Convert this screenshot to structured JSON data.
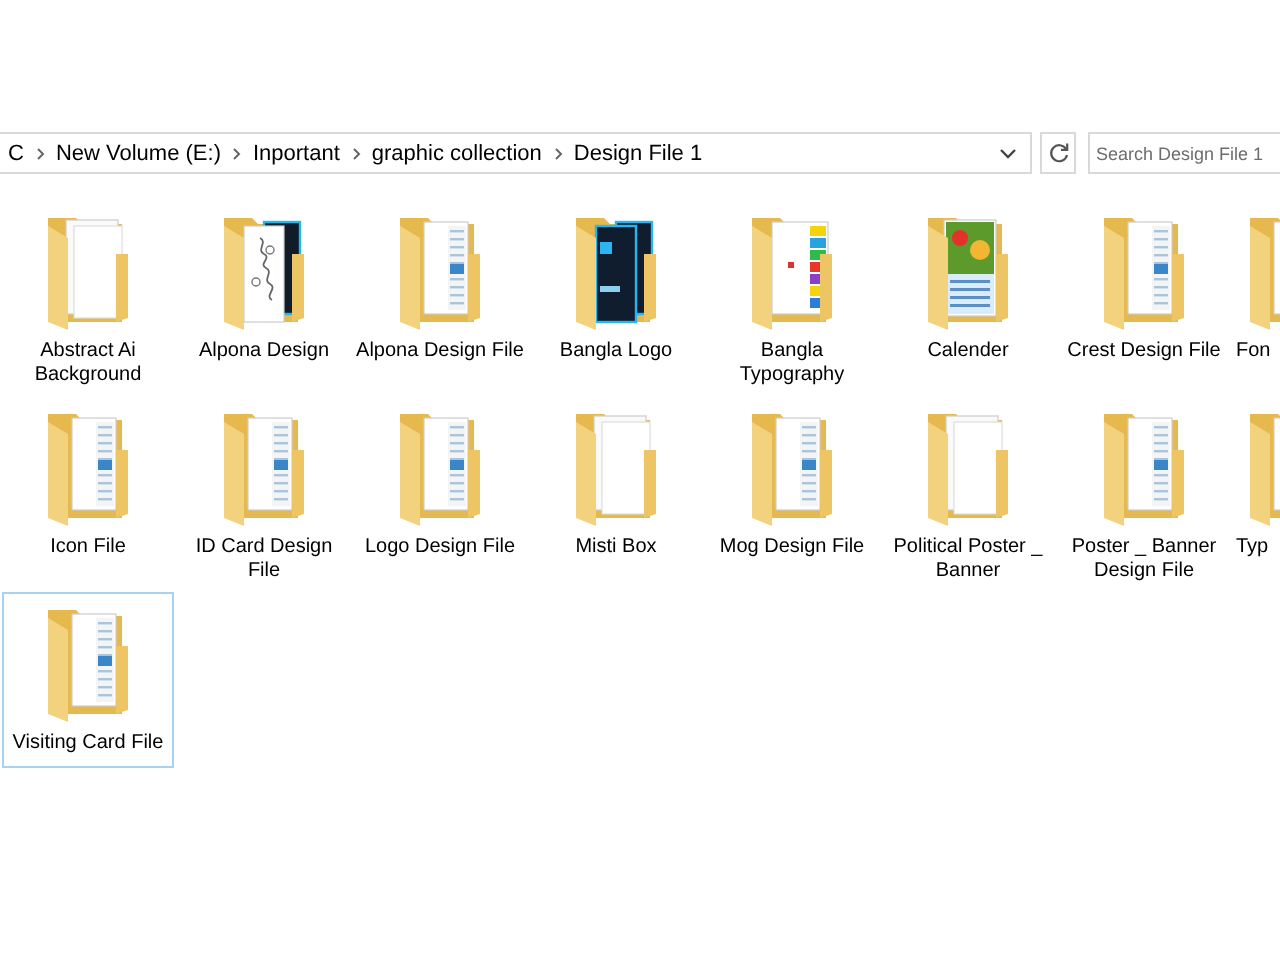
{
  "address_bar": {
    "breadcrumbs": [
      "C",
      "New Volume (E:)",
      "Inportant",
      "graphic collection",
      "Design File 1"
    ]
  },
  "search": {
    "placeholder": "Search Design File 1"
  },
  "items": [
    {
      "name": "Abstract Ai Background",
      "kind": "blank",
      "selected": false
    },
    {
      "name": "Alpona Design",
      "kind": "pattern",
      "selected": false
    },
    {
      "name": "Alpona Design File",
      "kind": "docs",
      "selected": false
    },
    {
      "name": "Bangla Logo",
      "kind": "psd",
      "selected": false
    },
    {
      "name": "Bangla Typography",
      "kind": "colorful",
      "selected": false
    },
    {
      "name": "Calender",
      "kind": "picture",
      "selected": false
    },
    {
      "name": "Crest Design File",
      "kind": "docs",
      "selected": false
    },
    {
      "name": "Fon",
      "kind": "docs",
      "selected": false
    },
    {
      "name": "Icon File",
      "kind": "docs",
      "selected": false
    },
    {
      "name": "ID Card Design File",
      "kind": "docs",
      "selected": false
    },
    {
      "name": "Logo Design File",
      "kind": "docs",
      "selected": false
    },
    {
      "name": "Misti Box",
      "kind": "blank",
      "selected": false
    },
    {
      "name": "Mog Design File",
      "kind": "docs",
      "selected": false
    },
    {
      "name": "Political Poster _ Banner",
      "kind": "blank",
      "selected": false
    },
    {
      "name": "Poster _ Banner Design File",
      "kind": "docs",
      "selected": false
    },
    {
      "name": "Typ",
      "kind": "docs",
      "selected": false
    },
    {
      "name": "Visiting Card File",
      "kind": "docs",
      "selected": true
    }
  ]
}
